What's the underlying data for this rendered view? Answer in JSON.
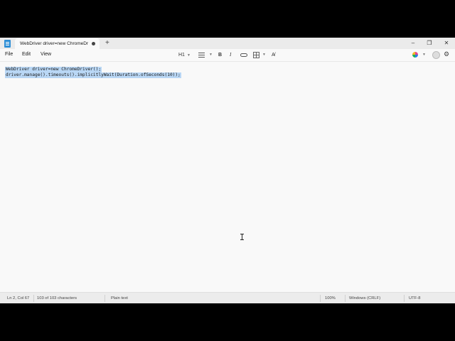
{
  "titlebar": {
    "tab_title": "WebDriver driver=new ChromeDriver",
    "new_tab": "+",
    "minimize": "–",
    "maximize": "❐",
    "close": "✕"
  },
  "menu": {
    "file": "File",
    "edit": "Edit",
    "view": "View"
  },
  "toolbar": {
    "heading": "H1",
    "bold": "B",
    "italic": "I",
    "clear_format": "A̸"
  },
  "editor": {
    "lines": [
      "WebDriver driver=new ChromeDriver();",
      "driver.manage().timeouts().implicitlyWait(Duration.ofSeconds(10));"
    ]
  },
  "status": {
    "position": "Ln 2, Col 67",
    "characters": "103 of 103 characters",
    "format": "Plain text",
    "zoom": "100%",
    "line_ending": "Windows (CRLF)",
    "encoding": "UTF-8"
  }
}
